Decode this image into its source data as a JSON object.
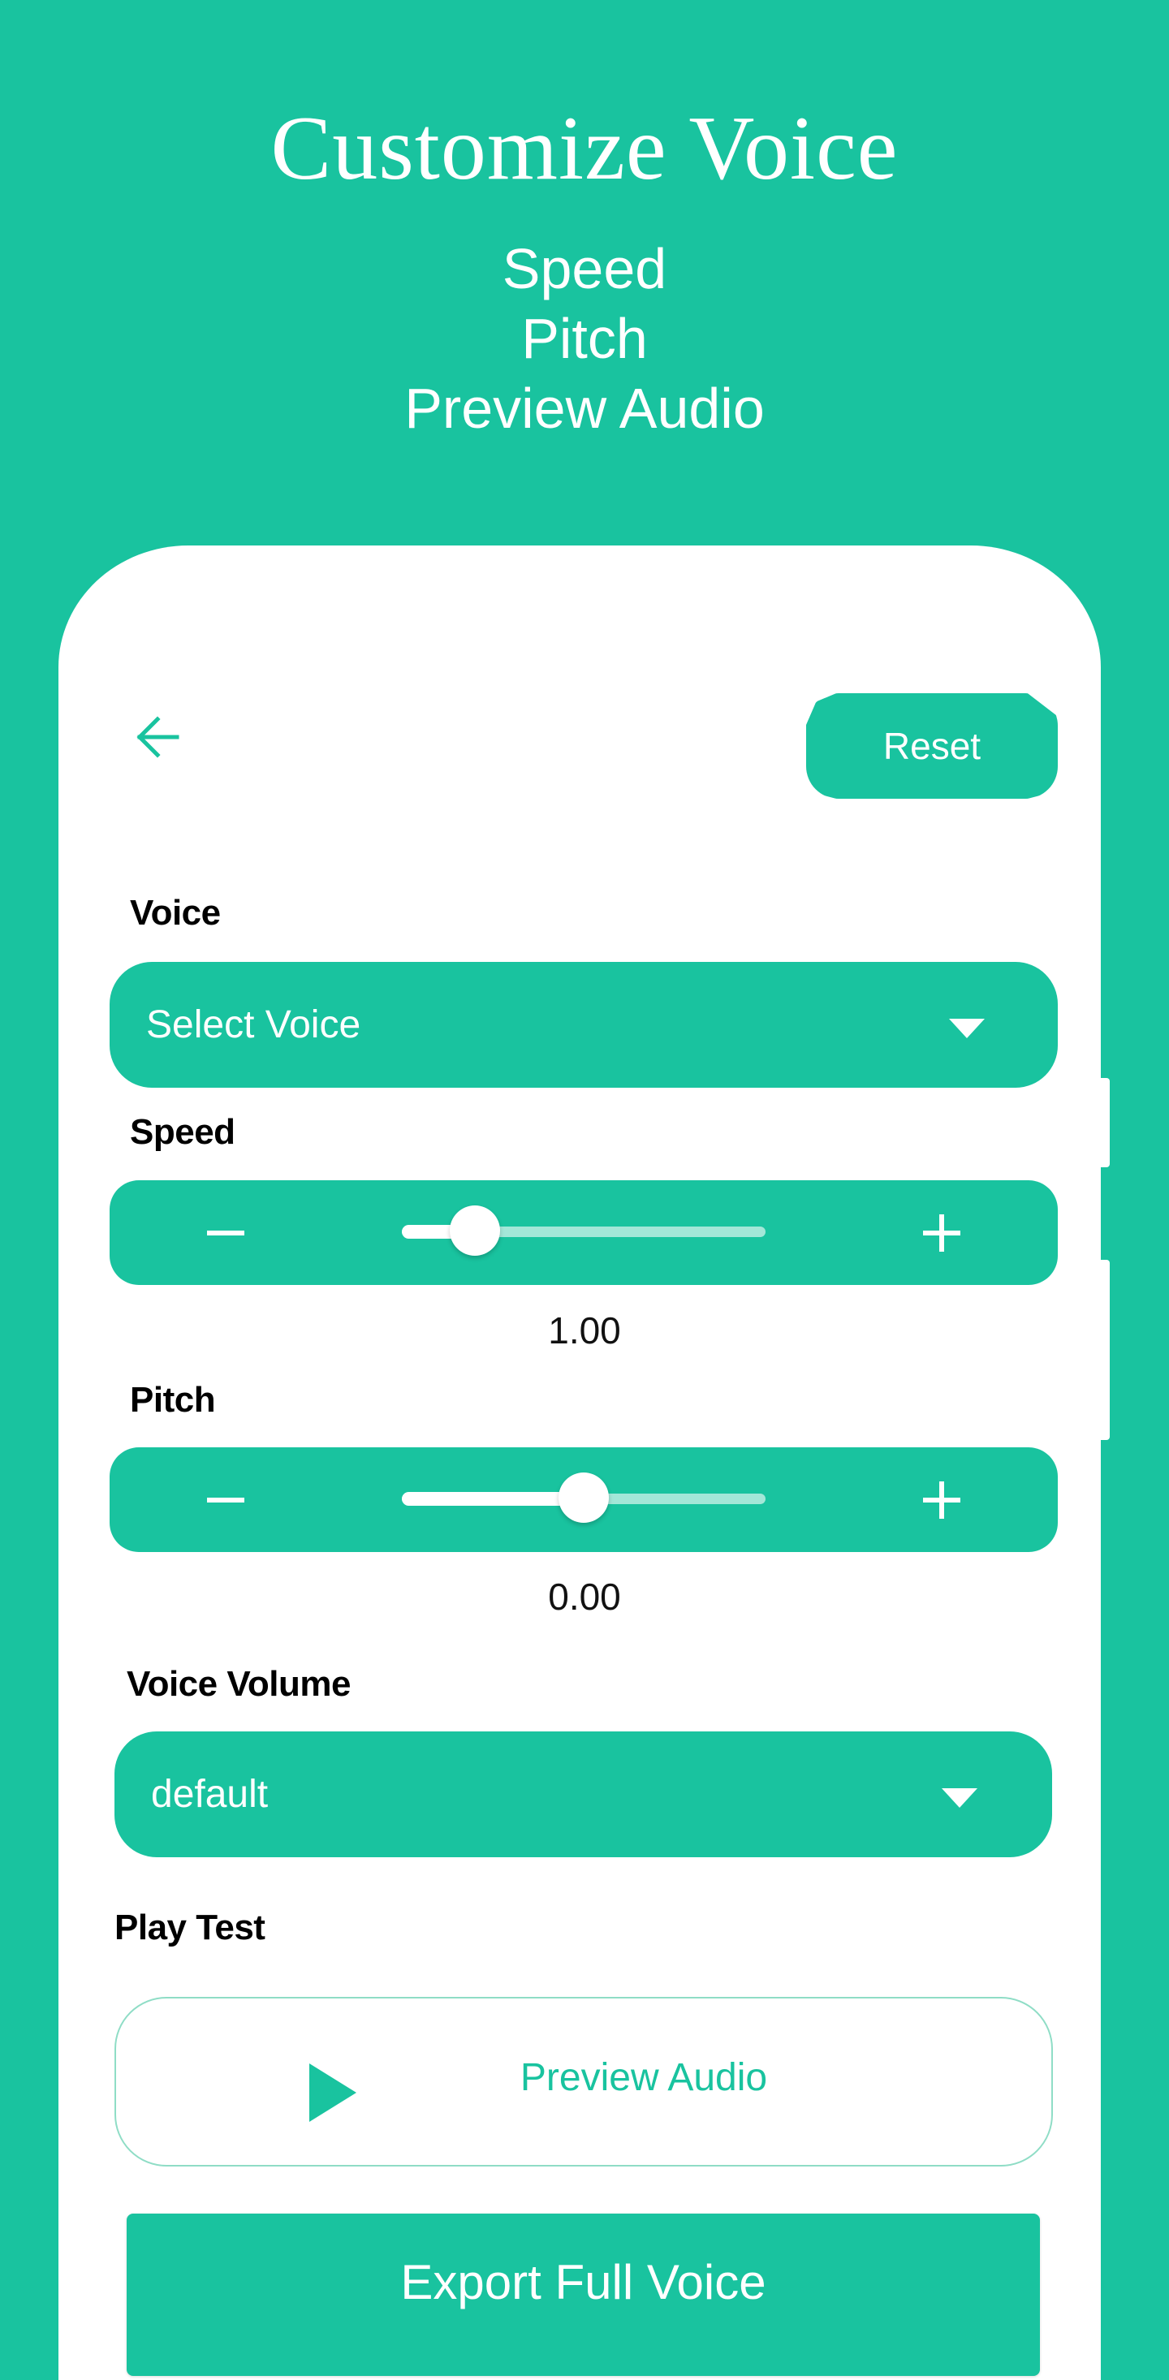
{
  "hero": {
    "title": "Customize Voice",
    "features": [
      "Speed",
      "Pitch",
      "Preview Audio"
    ]
  },
  "theme": {
    "accent": "#19c39f",
    "card": "#ffffff",
    "text": "#000000"
  },
  "toolbar": {
    "back_icon": "arrow-left-icon",
    "reset_label": "Reset"
  },
  "voice": {
    "label": "Voice",
    "selected": "Select Voice",
    "caret_icon": "caret-down-icon"
  },
  "speed": {
    "label": "Speed",
    "value_text": "1.00",
    "slider_fraction": 0.2,
    "minus_icon": "minus-icon",
    "plus_icon": "plus-icon"
  },
  "pitch": {
    "label": "Pitch",
    "value_text": "0.00",
    "slider_fraction": 0.5,
    "minus_icon": "minus-icon",
    "plus_icon": "plus-icon"
  },
  "volume": {
    "label": "Voice Volume",
    "selected": "default",
    "caret_icon": "caret-down-icon"
  },
  "play_test": {
    "label": "Play Test",
    "preview_label": "Preview Audio",
    "play_icon": "play-icon"
  },
  "export": {
    "label": "Export Full Voice"
  }
}
